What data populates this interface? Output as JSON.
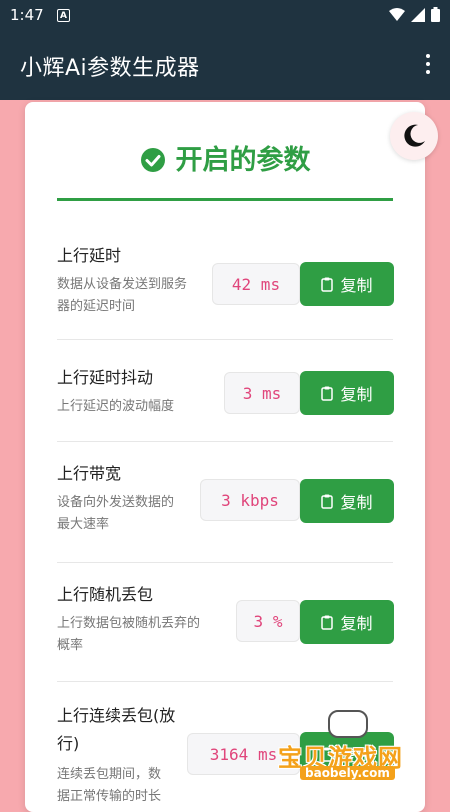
{
  "status_bar": {
    "time": "1:47",
    "notification_badge": "A"
  },
  "app_bar": {
    "title": "小辉Ai参数生成器"
  },
  "header": {
    "title": "开启的参数"
  },
  "params": [
    {
      "name": "上行延时",
      "desc_lines": [
        "数据从设备发送到服务",
        "器的延迟时间"
      ],
      "value": "42 ms",
      "copy_label": "复制"
    },
    {
      "name": "上行延时抖动",
      "desc_lines": [
        "上行延迟的波动幅度"
      ],
      "value": "3 ms",
      "copy_label": "复制"
    },
    {
      "name": "上行带宽",
      "desc_lines": [
        "设备向外发送数据的",
        "最大速率"
      ],
      "value": "3 kbps",
      "copy_label": "复制"
    },
    {
      "name": "上行随机丢包",
      "desc_lines": [
        "上行数据包被随机丢弃的",
        "概率"
      ],
      "value": "3 %",
      "copy_label": "复制"
    },
    {
      "name_lines": [
        "上行连续丢包(放",
        "行)"
      ],
      "desc_lines": [
        "连续丢包期间，数",
        "据正常传输的时长"
      ],
      "value": "3164 ms",
      "copy_label": "复制"
    }
  ],
  "watermark": {
    "brand": "宝贝游戏网",
    "domain": "baobely.com"
  },
  "colors": {
    "accent": "#2f9e44",
    "value_text": "#e0457b",
    "app_bar": "#1f3340",
    "background": "#f7a9ae"
  }
}
